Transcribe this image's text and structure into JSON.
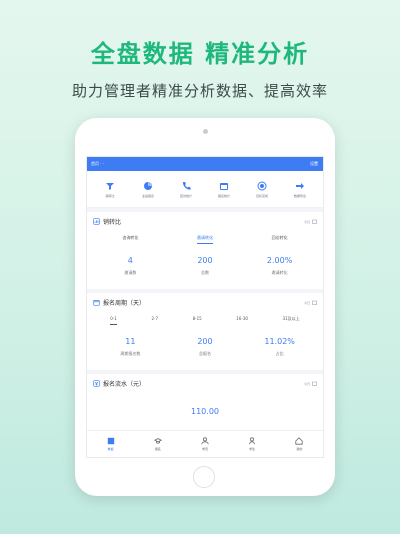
{
  "headline": "全盘数据  精准分析",
  "subline": "助力管理者精准分析数据、提高效率",
  "topbar": {
    "left": "首页    ·    ·",
    "right": "设置"
  },
  "shortcuts": [
    {
      "icon": "funnel-icon",
      "label": "销转比"
    },
    {
      "icon": "pie-chart-icon",
      "label": "业绩报表"
    },
    {
      "icon": "phone-icon",
      "label": "回访统计"
    },
    {
      "icon": "calendar-icon",
      "label": "报名统计"
    },
    {
      "icon": "target-icon",
      "label": "目标完成"
    },
    {
      "icon": "arrow-icon",
      "label": "数据导出"
    }
  ],
  "card1": {
    "title": "销转比",
    "date": "今日",
    "tabs": [
      "咨询转化",
      "邀请转化",
      "回访转化"
    ],
    "values": [
      {
        "value": "4",
        "label": "邀请数"
      },
      {
        "value": "200",
        "label": "总数"
      },
      {
        "value": "2.00%",
        "label": "邀请转化"
      }
    ]
  },
  "card2": {
    "title": "报名周期（天）",
    "date": "今日",
    "tabs": [
      "0-1",
      "2-7",
      "8-15",
      "16-30",
      "31及以上"
    ],
    "values": [
      {
        "value": "11",
        "label": "周期报名数"
      },
      {
        "value": "200",
        "label": "总报名"
      },
      {
        "value": "11.02%",
        "label": "占比"
      }
    ]
  },
  "card3": {
    "title": "报名流水（元）",
    "date": "今日",
    "value": "110.00"
  },
  "bottomnav": [
    {
      "icon": "dashboard-icon",
      "label": "看板"
    },
    {
      "icon": "graduation-icon",
      "label": "报名"
    },
    {
      "icon": "people-icon",
      "label": "学员"
    },
    {
      "icon": "user-icon",
      "label": "学生"
    },
    {
      "icon": "home-icon",
      "label": "我的"
    }
  ],
  "colors": {
    "accent": "#3d7cf2",
    "headline": "#1fb87c"
  }
}
